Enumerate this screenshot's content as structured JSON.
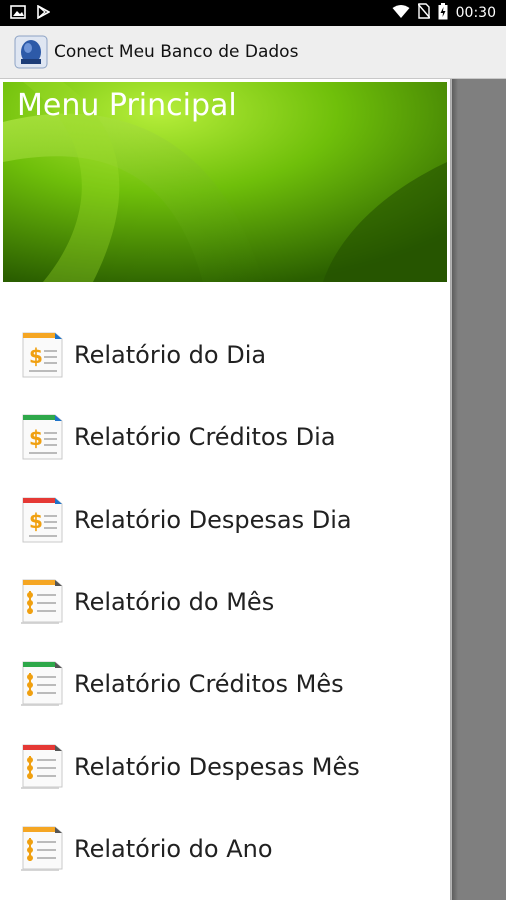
{
  "status_bar": {
    "time": "00:30",
    "icons": [
      "image-icon",
      "play-store-icon",
      "wifi-icon",
      "no-sim-icon",
      "battery-charging-icon"
    ]
  },
  "app_bar": {
    "title": "Conect Meu Banco de Dados",
    "icon": "app-logo-icon"
  },
  "drawer": {
    "header_title": "Menu Principal",
    "items": [
      {
        "label": "Relatório do Dia",
        "icon": "daily-report-icon",
        "accent": "#f5a623"
      },
      {
        "label": "Relatório Créditos Dia",
        "icon": "daily-credits-report-icon",
        "accent": "#2ea84a"
      },
      {
        "label": "Relatório Despesas Dia",
        "icon": "daily-expenses-report-icon",
        "accent": "#e53935"
      },
      {
        "label": "Relatório do Mês",
        "icon": "monthly-report-icon",
        "accent": "#f5a623"
      },
      {
        "label": "Relatório Créditos Mês",
        "icon": "monthly-credits-report-icon",
        "accent": "#2ea84a"
      },
      {
        "label": "Relatório Despesas Mês",
        "icon": "monthly-expenses-report-icon",
        "accent": "#e53935"
      },
      {
        "label": "Relatório do Ano",
        "icon": "yearly-report-icon",
        "accent": "#f5a623"
      }
    ]
  },
  "colors": {
    "header_green_light": "#8fd400",
    "header_green_dark": "#2f6a00",
    "scrim": "#7f7f7f"
  }
}
